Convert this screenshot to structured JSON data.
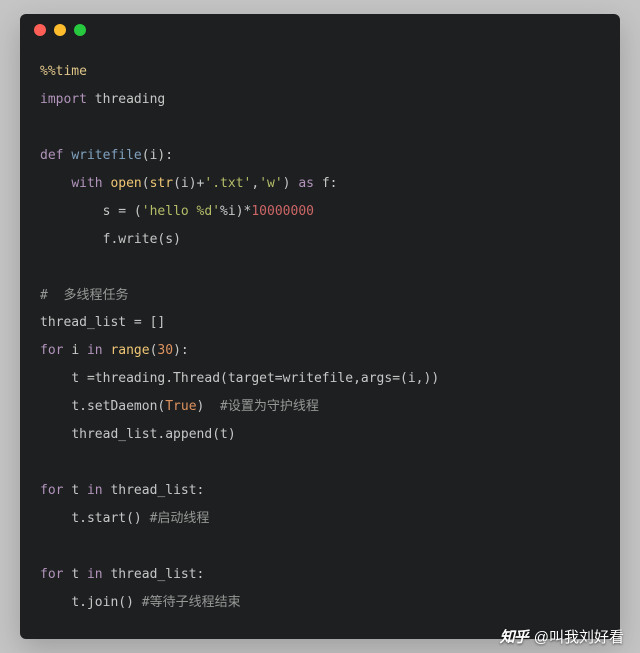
{
  "code": {
    "l1_magic": "%%time",
    "l2_import": "import",
    "l2_module": "threading",
    "l3_def": "def",
    "l3_func": "writefile",
    "l3_sig_open": "(i):",
    "l4_with": "with",
    "l4_open": "open",
    "l4_str": "str",
    "l4_paren_i_plus": "(i)+",
    "l4_txt": "'.txt'",
    "l4_comma": ",",
    "l4_w": "'w'",
    "l4_close_as": ")",
    "l4_as": "as",
    "l4_f": "f:",
    "l5_assign": "s = (",
    "l5_hello": "'hello %d'",
    "l5_pct_i_close_star": "%i)*",
    "l5_num": "10000000",
    "l6_write": "f.write(s)",
    "l7_comment": "#  多线程任务",
    "l8_threadlist": "thread_list = []",
    "l9_for": "for",
    "l9_var": "i",
    "l9_in": "in",
    "l9_range": "range",
    "l9_open": "(",
    "l9_num": "30",
    "l9_close": "):",
    "l10_text": "t =threading.Thread(target=writefile,args=(i,))",
    "l11_call": "t.setDaemon(",
    "l11_true": "True",
    "l11_close": ")",
    "l11_comment": "#设置为守护线程",
    "l12_text": "thread_list.append(t)",
    "l13_for": "for",
    "l13_var": "t",
    "l13_in": "in",
    "l13_list": "thread_list:",
    "l14_call": "t.start()",
    "l14_comment": "#启动线程",
    "l15_for": "for",
    "l15_var": "t",
    "l15_in": "in",
    "l15_list": "thread_list:",
    "l16_call": "t.join()",
    "l16_comment": "#等待子线程结束"
  },
  "watermark": {
    "logo": "知乎",
    "author": "@叫我刘好看"
  }
}
